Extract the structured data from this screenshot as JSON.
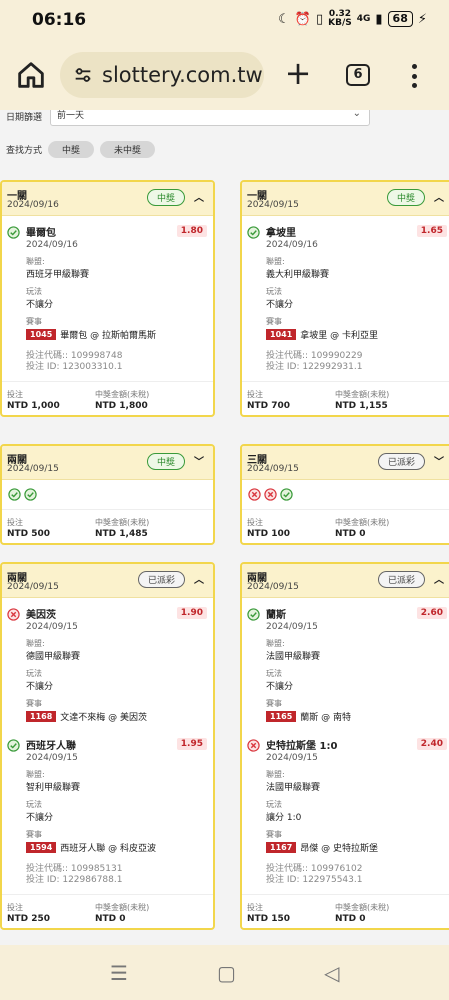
{
  "status_bar": {
    "time": "06:16",
    "net_speed": "0.32",
    "net_unit": "KB/S",
    "signal": "4G",
    "battery": "68"
  },
  "browser": {
    "url": "slottery.com.tw",
    "tab_count": "6"
  },
  "filters": {
    "date_label": "日期篩選",
    "date_value": "前一天",
    "search_label": "查找方式",
    "options": [
      "中獎",
      "未中獎"
    ]
  },
  "cards": [
    {
      "type": "一關",
      "date": "2024/09/16",
      "badge": "中獎",
      "badge_style": "win",
      "expanded": true,
      "legs": [
        {
          "status": "win",
          "team": "畢爾包",
          "date": "2024/09/16",
          "odds": "1.80",
          "league_label": "聯盟:",
          "league": "西班牙甲級聯賽",
          "play_label": "玩法",
          "play": "不讓分",
          "match_label": "賽事",
          "match_id": "1045",
          "match": "畢爾包 @ 拉斯帕爾馬斯"
        }
      ],
      "bet_code": "投注代碼:: 109998748",
      "bet_id": "投注 ID: 123003310.1",
      "stake_label": "投注",
      "stake": "NTD 1,000",
      "prize_label": "中獎金額(未稅)",
      "prize": "NTD 1,800"
    },
    {
      "type": "一關",
      "date": "2024/09/15",
      "badge": "中獎",
      "badge_style": "win",
      "expanded": true,
      "legs": [
        {
          "status": "win",
          "team": "拿坡里",
          "date": "2024/09/16",
          "odds": "1.65",
          "league_label": "聯盟:",
          "league": "義大利甲級聯賽",
          "play_label": "玩法",
          "play": "不讓分",
          "match_label": "賽事",
          "match_id": "1041",
          "match": "拿坡里 @ 卡利亞里"
        }
      ],
      "bet_code": "投注代碼:: 109990229",
      "bet_id": "投注 ID: 122992931.1",
      "stake_label": "投注",
      "stake": "NTD 700",
      "prize_label": "中獎金額(未稅)",
      "prize": "NTD 1,155"
    },
    {
      "type": "兩關",
      "date": "2024/09/15",
      "badge": "中獎",
      "badge_style": "win",
      "expanded": false,
      "results": [
        "win",
        "win"
      ],
      "stake_label": "投注",
      "stake": "NTD 500",
      "prize_label": "中獎金額(未稅)",
      "prize": "NTD 1,485"
    },
    {
      "type": "三關",
      "date": "2024/09/15",
      "badge": "已派彩",
      "badge_style": "done",
      "expanded": false,
      "results": [
        "lose",
        "lose",
        "win"
      ],
      "stake_label": "投注",
      "stake": "NTD 100",
      "prize_label": "中獎金額(未稅)",
      "prize": "NTD 0"
    },
    {
      "type": "兩關",
      "date": "2024/09/15",
      "badge": "已派彩",
      "badge_style": "done",
      "expanded": true,
      "legs": [
        {
          "status": "lose",
          "team": "美因茨",
          "date": "2024/09/15",
          "odds": "1.90",
          "league_label": "聯盟:",
          "league": "德國甲級聯賽",
          "play_label": "玩法",
          "play": "不讓分",
          "match_label": "賽事",
          "match_id": "1168",
          "match": "文達不來梅 @ 美因茨"
        },
        {
          "status": "win",
          "team": "西班牙人聯",
          "date": "2024/09/15",
          "odds": "1.95",
          "league_label": "聯盟:",
          "league": "智利甲級聯賽",
          "play_label": "玩法",
          "play": "不讓分",
          "match_label": "賽事",
          "match_id": "1594",
          "match": "西班牙人聯 @ 科皮亞波"
        }
      ],
      "bet_code": "投注代碼:: 109985131",
      "bet_id": "投注 ID: 122986788.1",
      "stake_label": "投注",
      "stake": "NTD 250",
      "prize_label": "中獎金額(未稅)",
      "prize": "NTD 0"
    },
    {
      "type": "兩關",
      "date": "2024/09/15",
      "badge": "已派彩",
      "badge_style": "done",
      "expanded": true,
      "legs": [
        {
          "status": "win",
          "team": "蘭斯",
          "date": "2024/09/15",
          "odds": "2.60",
          "league_label": "聯盟:",
          "league": "法國甲級聯賽",
          "play_label": "玩法",
          "play": "不讓分",
          "match_label": "賽事",
          "match_id": "1165",
          "match": "蘭斯 @ 南特"
        },
        {
          "status": "lose",
          "team": "史特拉斯堡 1:0",
          "date": "2024/09/15",
          "odds": "2.40",
          "league_label": "聯盟:",
          "league": "法國甲級聯賽",
          "play_label": "玩法",
          "play": "讓分 1:0",
          "match_label": "賽事",
          "match_id": "1167",
          "match": "昂傑 @ 史特拉斯堡"
        }
      ],
      "bet_code": "投注代碼:: 109976102",
      "bet_id": "投注 ID: 122975543.1",
      "stake_label": "投注",
      "stake": "NTD 150",
      "prize_label": "中獎金額(未稅)",
      "prize": "NTD 0"
    }
  ],
  "colors": {
    "accent_border": "#f2d64b",
    "win": "#3a9a3a",
    "lose": "#d9363e",
    "odds_text": "#c0262b"
  },
  "icons": {
    "home": "home-icon",
    "tune": "tune-icon",
    "plus": "plus-icon",
    "tabs": "tabs-icon",
    "menu": "more-vert-icon"
  }
}
